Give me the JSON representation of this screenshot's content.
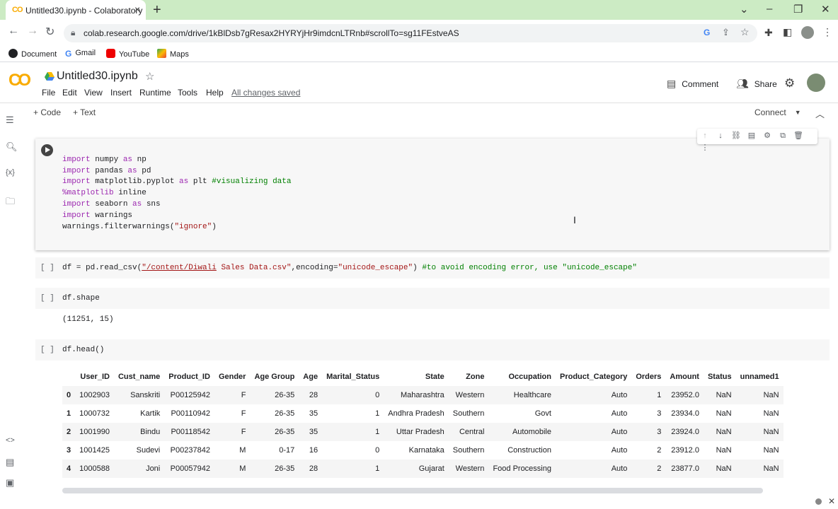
{
  "browser": {
    "tab_title": "Untitled30.ipynb - Colaboratory",
    "tab_icon_text": "CO",
    "new_tab": "+",
    "url": "colab.research.google.com/drive/1kBlDsb7gResax2HYRYjHr9imdcnLTRnb#scrollTo=sg11FEstveAS",
    "bookmarks": [
      "Document",
      "Gmail",
      "YouTube",
      "Maps"
    ]
  },
  "colab": {
    "logo": "CO",
    "notebook_title": "Untitled30.ipynb",
    "menus": [
      "File",
      "Edit",
      "View",
      "Insert",
      "Runtime",
      "Tools",
      "Help"
    ],
    "saved_status": "All changes saved",
    "comment_label": "Comment",
    "share_label": "Share",
    "add_code": "+ Code",
    "add_text": "+ Text",
    "connect_label": "Connect"
  },
  "cells": {
    "cell1_lines": [
      "import numpy as np",
      "import pandas as pd",
      "import matplotlib.pyplot as plt #visualizing data",
      "%matplotlib inline",
      "import seaborn as sns",
      "import warnings",
      "warnings.filterwarnings(\"ignore\")"
    ],
    "cell2": "df = pd.read_csv(\"/content/Diwali Sales Data.csv\",encoding=\"unicode_escape\") #to avoid encoding error, use \"unicode_escape\"",
    "cell3": "df.shape",
    "cell3_output": "(11251, 15)",
    "cell4": "df.head()",
    "bracket": "[ ]"
  },
  "table": {
    "columns": [
      "",
      "User_ID",
      "Cust_name",
      "Product_ID",
      "Gender",
      "Age Group",
      "Age",
      "Marital_Status",
      "State",
      "Zone",
      "Occupation",
      "Product_Category",
      "Orders",
      "Amount",
      "Status",
      "unnamed1"
    ],
    "rows": [
      [
        "0",
        "1002903",
        "Sanskriti",
        "P00125942",
        "F",
        "26-35",
        "28",
        "0",
        "Maharashtra",
        "Western",
        "Healthcare",
        "Auto",
        "1",
        "23952.0",
        "NaN",
        "NaN"
      ],
      [
        "1",
        "1000732",
        "Kartik",
        "P00110942",
        "F",
        "26-35",
        "35",
        "1",
        "Andhra Pradesh",
        "Southern",
        "Govt",
        "Auto",
        "3",
        "23934.0",
        "NaN",
        "NaN"
      ],
      [
        "2",
        "1001990",
        "Bindu",
        "P00118542",
        "F",
        "26-35",
        "35",
        "1",
        "Uttar Pradesh",
        "Central",
        "Automobile",
        "Auto",
        "3",
        "23924.0",
        "NaN",
        "NaN"
      ],
      [
        "3",
        "1001425",
        "Sudevi",
        "P00237842",
        "M",
        "0-17",
        "16",
        "0",
        "Karnataka",
        "Southern",
        "Construction",
        "Auto",
        "2",
        "23912.0",
        "NaN",
        "NaN"
      ],
      [
        "4",
        "1000588",
        "Joni",
        "P00057942",
        "M",
        "26-35",
        "28",
        "1",
        "Gujarat",
        "Western",
        "Food Processing",
        "Auto",
        "2",
        "23877.0",
        "NaN",
        "NaN"
      ]
    ]
  },
  "colors": {
    "tab_bar": "#ccebc4",
    "colab_orange": "#f9ab00",
    "cell_bg": "#f7f7f7"
  }
}
